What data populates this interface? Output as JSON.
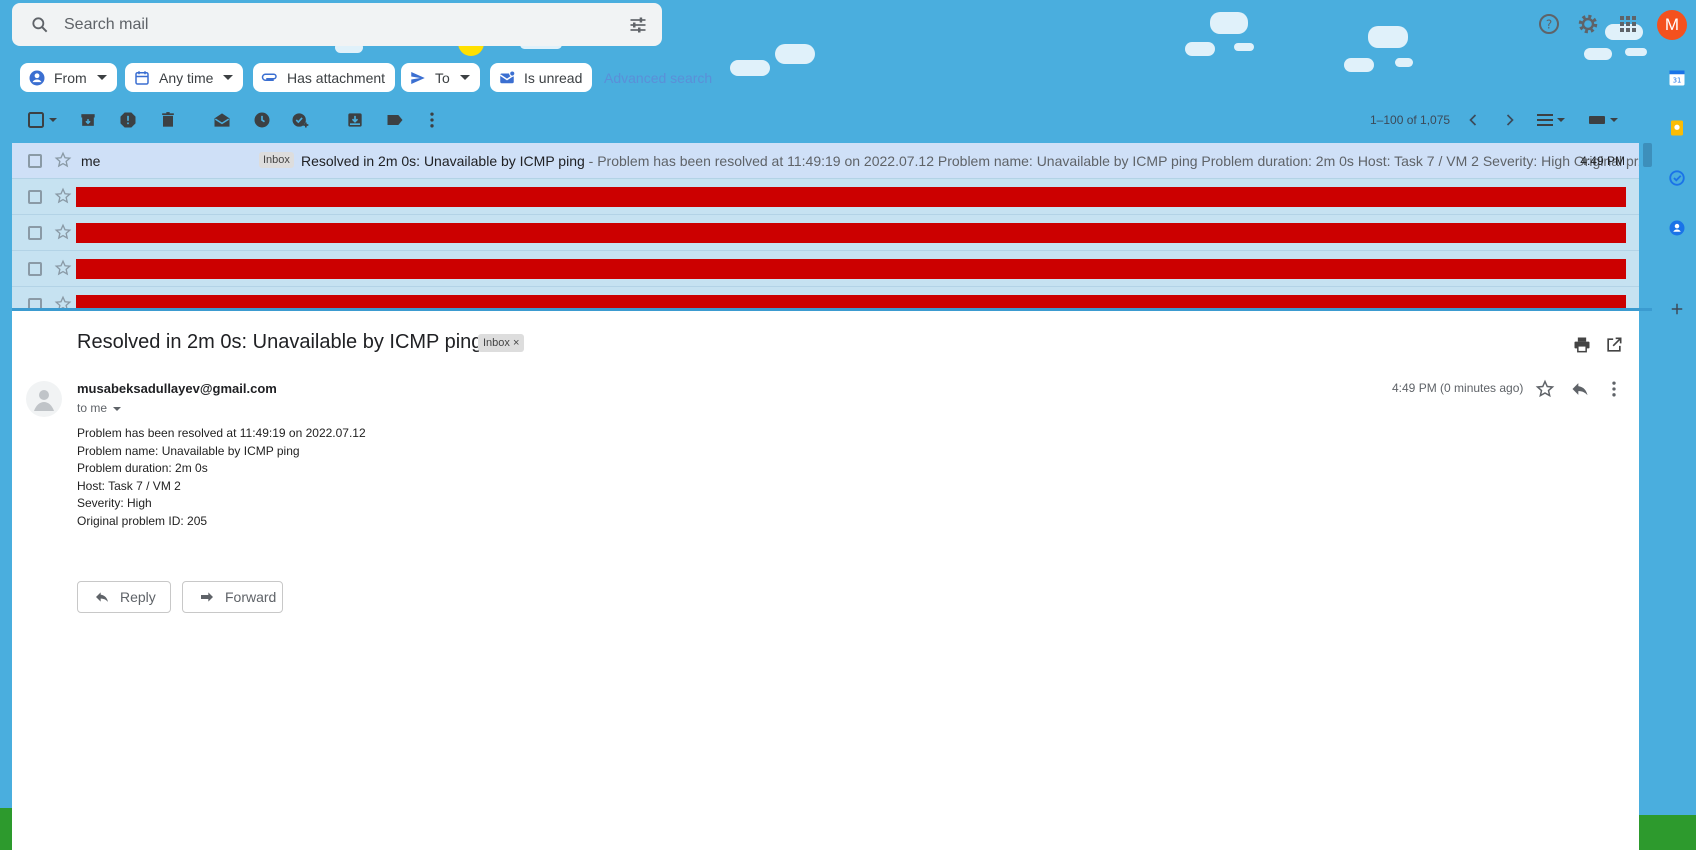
{
  "search": {
    "placeholder": "Search mail"
  },
  "account": {
    "initial": "M"
  },
  "chips": [
    {
      "label": "From"
    },
    {
      "label": "Any time"
    },
    {
      "label": "Has attachment"
    },
    {
      "label": "To"
    },
    {
      "label": "Is unread"
    }
  ],
  "advanced_search": "Advanced search",
  "pager": {
    "range": "1–100 of 1,075"
  },
  "list": {
    "first_row": {
      "sender": "me",
      "label": "Inbox",
      "subject": "Resolved in 2m 0s: Unavailable by ICMP ping",
      "snippet": " - Problem has been resolved at 11:49:19 on 2022.07.12 Problem name: Unavailable by ICMP ping Problem duration: 2m 0s Host: Task 7 / VM 2 Severity: High Original pr...",
      "time": "4:49 PM"
    }
  },
  "message": {
    "subject": "Resolved in 2m 0s: Unavailable by ICMP ping",
    "label": "Inbox",
    "label_remove": "×",
    "from": "musabeksadullayev@gmail.com",
    "to": "to me",
    "time": "4:49 PM (0 minutes ago)",
    "body": [
      "Problem has been resolved at 11:49:19 on 2022.07.12",
      "Problem name: Unavailable by ICMP ping",
      "Problem duration: 2m 0s",
      "Host: Task 7 / VM 2",
      "Severity: High",
      "Original problem ID: 205"
    ],
    "reply_label": "Reply",
    "forward_label": "Forward"
  },
  "colors": {
    "background": "#4aaede",
    "redacted": "#cc0000",
    "avatar": "#f4511e"
  }
}
